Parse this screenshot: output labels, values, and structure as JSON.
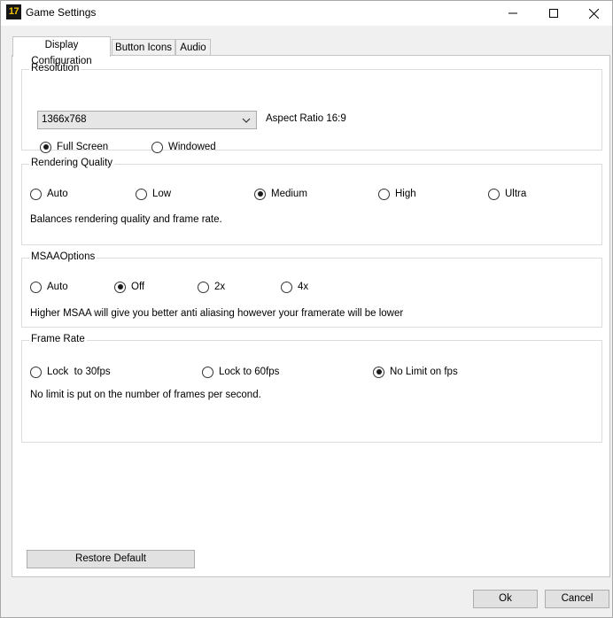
{
  "window": {
    "title": "Game Settings",
    "app_icon_text": "17",
    "controls": [
      "minimize-icon",
      "maximize-icon",
      "close-icon"
    ]
  },
  "tabs": [
    {
      "label": "Display Configuration",
      "active": true
    },
    {
      "label": "Button Icons",
      "active": false
    },
    {
      "label": "Audio",
      "active": false
    }
  ],
  "resolution": {
    "group_label": "Resolution",
    "selected": "1366x768",
    "aspect_ratio": "Aspect Ratio 16:9",
    "modes": [
      {
        "label": "Full Screen",
        "checked": true
      },
      {
        "label": "Windowed",
        "checked": false
      }
    ]
  },
  "rendering_quality": {
    "group_label": "Rendering Quality",
    "options": [
      {
        "label": "Auto",
        "checked": false
      },
      {
        "label": "Low",
        "checked": false
      },
      {
        "label": "Medium",
        "checked": true
      },
      {
        "label": "High",
        "checked": false
      },
      {
        "label": "Ultra",
        "checked": false
      }
    ],
    "description": "Balances rendering quality and frame rate."
  },
  "msaa": {
    "group_label": "MSAAOptions",
    "options": [
      {
        "label": "Auto",
        "checked": false
      },
      {
        "label": "Off",
        "checked": true
      },
      {
        "label": "2x",
        "checked": false
      },
      {
        "label": "4x",
        "checked": false
      }
    ],
    "description": "Higher MSAA will give you better anti aliasing however your framerate will be lower"
  },
  "frame_rate": {
    "group_label": "Frame Rate",
    "options": [
      {
        "label": "Lock  to 30fps",
        "checked": false
      },
      {
        "label": "Lock to 60fps",
        "checked": false
      },
      {
        "label": "No Limit on fps",
        "checked": true
      }
    ],
    "description": "No limit is put on the number of frames per second."
  },
  "buttons": {
    "restore_default": "Restore Default",
    "ok": "Ok",
    "cancel": "Cancel"
  }
}
